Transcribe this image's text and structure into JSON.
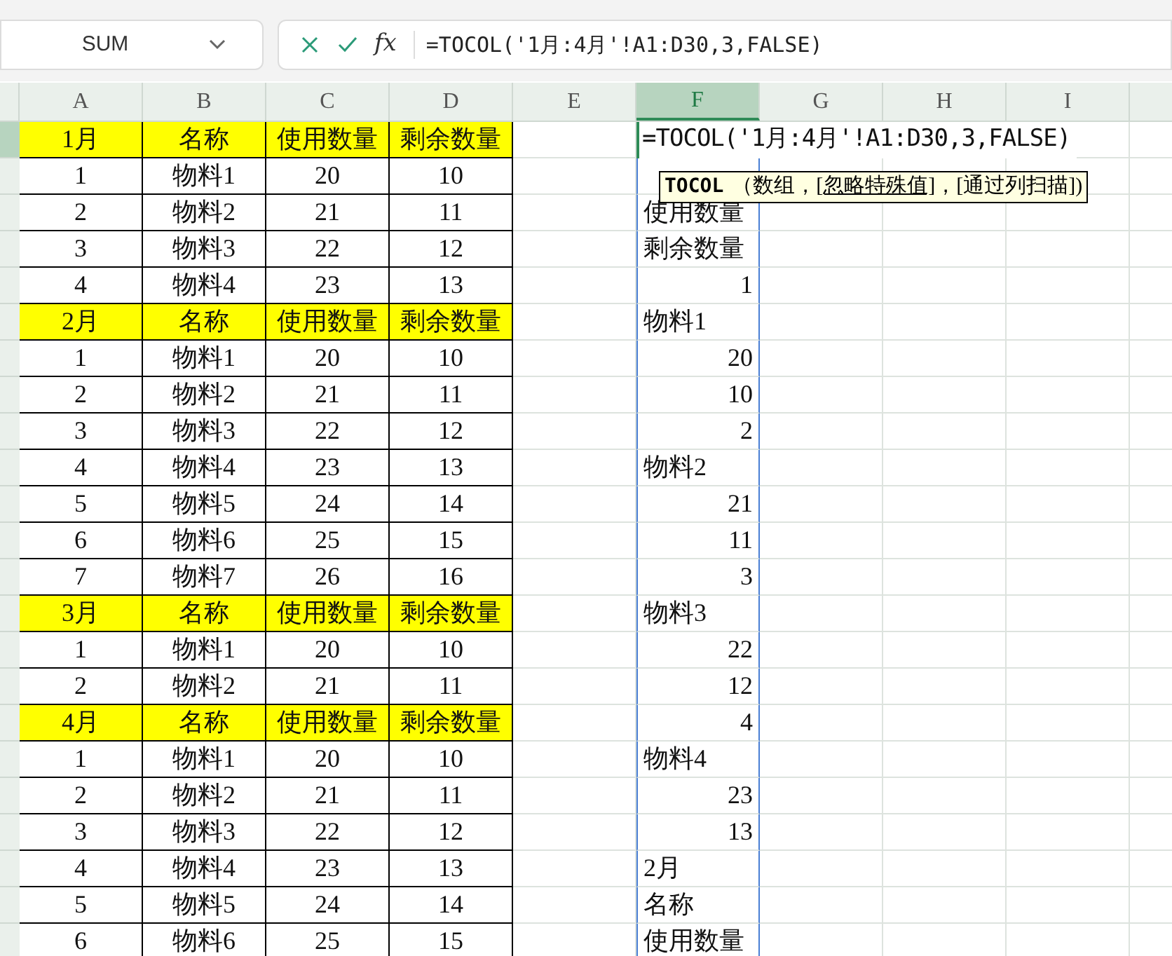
{
  "name_box": "SUM",
  "formula_bar": {
    "function_label": "fx",
    "formula": "=TOCOL('1月:4月'!A1:D30,3,FALSE)"
  },
  "columns": [
    {
      "label": "A",
      "selected": false
    },
    {
      "label": "B",
      "selected": false
    },
    {
      "label": "C",
      "selected": false
    },
    {
      "label": "D",
      "selected": false
    },
    {
      "label": "E",
      "selected": false
    },
    {
      "label": "F",
      "selected": true
    },
    {
      "label": "G",
      "selected": false
    },
    {
      "label": "H",
      "selected": false
    },
    {
      "label": "I",
      "selected": false
    }
  ],
  "rows": [
    {
      "selected": true,
      "header": true,
      "cells": [
        "1月",
        "名称",
        "使用数量",
        "剩余数量"
      ],
      "f_cell": {
        "text": "=TOCOL('1月:4月'!A1:D30,3,FALSE)",
        "kind": "editing"
      }
    },
    {
      "selected": false,
      "header": false,
      "cells": [
        "1",
        "物料1",
        "20",
        "10"
      ]
    },
    {
      "selected": false,
      "header": false,
      "cells": [
        "2",
        "物料2",
        "21",
        "11"
      ],
      "f_cell": {
        "text": "使用数量",
        "kind": "text"
      }
    },
    {
      "selected": false,
      "header": false,
      "cells": [
        "3",
        "物料3",
        "22",
        "12"
      ],
      "f_cell": {
        "text": "剩余数量",
        "kind": "text"
      }
    },
    {
      "selected": false,
      "header": false,
      "cells": [
        "4",
        "物料4",
        "23",
        "13"
      ],
      "f_cell": {
        "text": "1",
        "kind": "number"
      }
    },
    {
      "selected": false,
      "header": true,
      "cells": [
        "2月",
        "名称",
        "使用数量",
        "剩余数量"
      ],
      "f_cell": {
        "text": "物料1",
        "kind": "text"
      }
    },
    {
      "selected": false,
      "header": false,
      "cells": [
        "1",
        "物料1",
        "20",
        "10"
      ],
      "f_cell": {
        "text": "20",
        "kind": "number"
      }
    },
    {
      "selected": false,
      "header": false,
      "cells": [
        "2",
        "物料2",
        "21",
        "11"
      ],
      "f_cell": {
        "text": "10",
        "kind": "number"
      }
    },
    {
      "selected": false,
      "header": false,
      "cells": [
        "3",
        "物料3",
        "22",
        "12"
      ],
      "f_cell": {
        "text": "2",
        "kind": "number"
      }
    },
    {
      "selected": false,
      "header": false,
      "cells": [
        "4",
        "物料4",
        "23",
        "13"
      ],
      "f_cell": {
        "text": "物料2",
        "kind": "text"
      }
    },
    {
      "selected": false,
      "header": false,
      "cells": [
        "5",
        "物料5",
        "24",
        "14"
      ],
      "f_cell": {
        "text": "21",
        "kind": "number"
      }
    },
    {
      "selected": false,
      "header": false,
      "cells": [
        "6",
        "物料6",
        "25",
        "15"
      ],
      "f_cell": {
        "text": "11",
        "kind": "number"
      }
    },
    {
      "selected": false,
      "header": false,
      "cells": [
        "7",
        "物料7",
        "26",
        "16"
      ],
      "f_cell": {
        "text": "3",
        "kind": "number"
      }
    },
    {
      "selected": false,
      "header": true,
      "cells": [
        "3月",
        "名称",
        "使用数量",
        "剩余数量"
      ],
      "f_cell": {
        "text": "物料3",
        "kind": "text"
      }
    },
    {
      "selected": false,
      "header": false,
      "cells": [
        "1",
        "物料1",
        "20",
        "10"
      ],
      "f_cell": {
        "text": "22",
        "kind": "number"
      }
    },
    {
      "selected": false,
      "header": false,
      "cells": [
        "2",
        "物料2",
        "21",
        "11"
      ],
      "f_cell": {
        "text": "12",
        "kind": "number"
      }
    },
    {
      "selected": false,
      "header": true,
      "cells": [
        "4月",
        "名称",
        "使用数量",
        "剩余数量"
      ],
      "f_cell": {
        "text": "4",
        "kind": "number"
      }
    },
    {
      "selected": false,
      "header": false,
      "cells": [
        "1",
        "物料1",
        "20",
        "10"
      ],
      "f_cell": {
        "text": "物料4",
        "kind": "text"
      }
    },
    {
      "selected": false,
      "header": false,
      "cells": [
        "2",
        "物料2",
        "21",
        "11"
      ],
      "f_cell": {
        "text": "23",
        "kind": "number"
      }
    },
    {
      "selected": false,
      "header": false,
      "cells": [
        "3",
        "物料3",
        "22",
        "12"
      ],
      "f_cell": {
        "text": "13",
        "kind": "number"
      }
    },
    {
      "selected": false,
      "header": false,
      "cells": [
        "4",
        "物料4",
        "23",
        "13"
      ],
      "f_cell": {
        "text": "2月",
        "kind": "text"
      }
    },
    {
      "selected": false,
      "header": false,
      "cells": [
        "5",
        "物料5",
        "24",
        "14"
      ],
      "f_cell": {
        "text": "名称",
        "kind": "text"
      }
    },
    {
      "selected": false,
      "header": false,
      "cells": [
        "6",
        "物料6",
        "25",
        "15"
      ],
      "f_cell": {
        "text": "使用数量",
        "kind": "text"
      }
    }
  ],
  "tooltip": {
    "function": "TOCOL",
    "params": [
      {
        "text": "（数组，",
        "selected": false
      },
      {
        "text": "[忽略特殊值]",
        "selected": true
      },
      {
        "text": "，[通过列扫描])",
        "selected": false
      }
    ]
  }
}
